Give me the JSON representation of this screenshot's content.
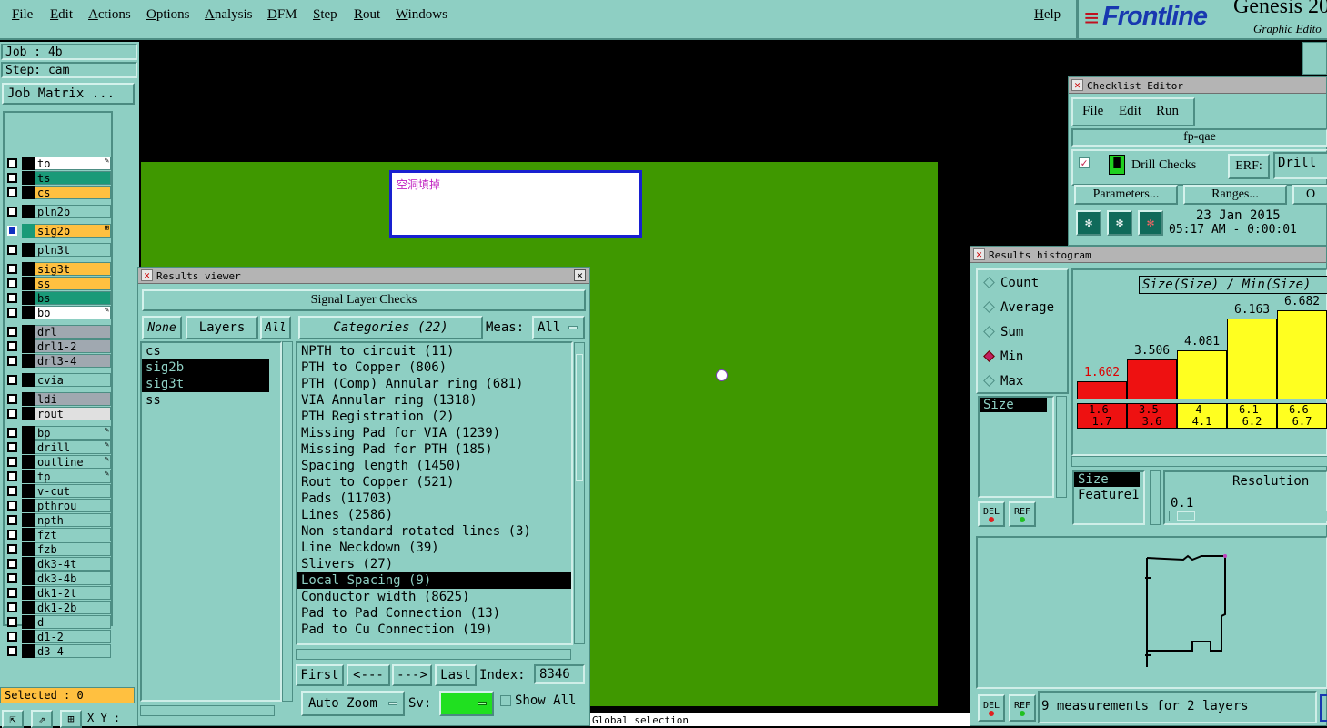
{
  "menu": {
    "items": [
      "File",
      "Edit",
      "Actions",
      "Options",
      "Analysis",
      "DFM",
      "Step",
      "Rout",
      "Windows"
    ],
    "help": "Help"
  },
  "logo": {
    "brand": "Frontline",
    "product": "Genesis 20",
    "subtitle": "Graphic Edito"
  },
  "job": {
    "job": "Job : 4b",
    "step": "Step: cam",
    "matrix_button": "Job Matrix ..."
  },
  "layers": [
    {
      "name": "to",
      "color": "#ffffff",
      "mark": "✎"
    },
    {
      "name": "ts",
      "color": "#1a9a78",
      "mark": ""
    },
    {
      "name": "cs",
      "color": "#ffc040",
      "mark": ""
    },
    {
      "name": "pln2b",
      "color": "#8ecfc3",
      "mark": ""
    },
    {
      "name": "sig2b",
      "color": "#ffc040",
      "mark": "⊞",
      "active": true
    },
    {
      "name": "pln3t",
      "color": "#8ecfc3",
      "mark": ""
    },
    {
      "name": "sig3t",
      "color": "#ffc040",
      "mark": ""
    },
    {
      "name": "ss",
      "color": "#ffc040",
      "mark": ""
    },
    {
      "name": "bs",
      "color": "#1a9a78",
      "mark": ""
    },
    {
      "name": "bo",
      "color": "#ffffff",
      "mark": "✎"
    },
    {
      "name": "drl",
      "color": "#a0a8b0",
      "mark": ""
    },
    {
      "name": "drl1-2",
      "color": "#a0a8b0",
      "mark": ""
    },
    {
      "name": "drl3-4",
      "color": "#a0a8b0",
      "mark": ""
    },
    {
      "name": "cvia",
      "color": "#8ecfc3",
      "mark": ""
    },
    {
      "name": "ldi",
      "color": "#a0a8b0",
      "mark": ""
    },
    {
      "name": "rout",
      "color": "#e0e0e0",
      "mark": ""
    },
    {
      "name": "bp",
      "color": "#8ecfc3",
      "mark": "✎"
    },
    {
      "name": "drill",
      "color": "#8ecfc3",
      "mark": "✎"
    },
    {
      "name": "outline",
      "color": "#8ecfc3",
      "mark": "✎"
    },
    {
      "name": "tp",
      "color": "#8ecfc3",
      "mark": "✎"
    },
    {
      "name": "v-cut",
      "color": "#8ecfc3",
      "mark": ""
    },
    {
      "name": "pthrou",
      "color": "#8ecfc3",
      "mark": ""
    },
    {
      "name": "npth",
      "color": "#8ecfc3",
      "mark": ""
    },
    {
      "name": "fzt",
      "color": "#8ecfc3",
      "mark": ""
    },
    {
      "name": "fzb",
      "color": "#8ecfc3",
      "mark": ""
    },
    {
      "name": "dk3-4t",
      "color": "#8ecfc3",
      "mark": ""
    },
    {
      "name": "dk3-4b",
      "color": "#8ecfc3",
      "mark": ""
    },
    {
      "name": "dk1-2t",
      "color": "#8ecfc3",
      "mark": ""
    },
    {
      "name": "dk1-2b",
      "color": "#8ecfc3",
      "mark": ""
    },
    {
      "name": "d",
      "color": "#8ecfc3",
      "mark": ""
    },
    {
      "name": "d1-2",
      "color": "#8ecfc3",
      "mark": ""
    },
    {
      "name": "d3-4",
      "color": "#8ecfc3",
      "mark": ""
    }
  ],
  "selected": "Selected : 0",
  "xy": "X Y :",
  "canvas": {
    "note": "空洞填掉",
    "status": "Global selection"
  },
  "results_viewer": {
    "title": "Results viewer",
    "header": "Signal Layer Checks",
    "none": "None",
    "layers": "Layers",
    "all": "All",
    "categories_btn": "Categories (22)",
    "meas_label": "Meas:",
    "meas_value": "All",
    "layer_list": [
      {
        "t": "cs",
        "sel": false
      },
      {
        "t": "sig2b",
        "sel": true
      },
      {
        "t": "sig3t",
        "sel": true
      },
      {
        "t": "ss",
        "sel": false
      }
    ],
    "category_list": [
      {
        "t": "NPTH to circuit (11)",
        "sel": false
      },
      {
        "t": "PTH to Copper (806)",
        "sel": false
      },
      {
        "t": "PTH (Comp) Annular ring (681)",
        "sel": false
      },
      {
        "t": "VIA Annular ring (1318)",
        "sel": false
      },
      {
        "t": "PTH Registration (2)",
        "sel": false
      },
      {
        "t": "Missing Pad for VIA (1239)",
        "sel": false
      },
      {
        "t": "Missing Pad for PTH (185)",
        "sel": false
      },
      {
        "t": "Spacing length (1450)",
        "sel": false
      },
      {
        "t": "Rout to Copper (521)",
        "sel": false
      },
      {
        "t": "Pads (11703)",
        "sel": false
      },
      {
        "t": "Lines (2586)",
        "sel": false
      },
      {
        "t": "Non standard rotated lines (3)",
        "sel": false
      },
      {
        "t": "Line Neckdown (39)",
        "sel": false
      },
      {
        "t": "Slivers (27)",
        "sel": false
      },
      {
        "t": "Local Spacing (9)",
        "sel": true
      },
      {
        "t": "Conductor width (8625)",
        "sel": false
      },
      {
        "t": "Pad to Pad Connection (13)",
        "sel": false
      },
      {
        "t": "Pad to Cu Connection (19)",
        "sel": false
      }
    ],
    "first": "First",
    "prev": "<---",
    "next": "--->",
    "last": "Last",
    "index_label": "Index:",
    "index_value": "8346",
    "zoom": "Auto Zoom",
    "sv": "Sv:",
    "show_all": "Show All"
  },
  "checklist": {
    "title": "Checklist Editor",
    "menu": [
      "File",
      "Edit",
      "Run"
    ],
    "name": "fp-qae",
    "check": "Drill Checks",
    "erf": "ERF:",
    "erf_value": "Drill",
    "params": "Parameters...",
    "ranges": "Ranges...",
    "o": "O",
    "date": "23 Jan 2015",
    "time": "05:17 AM - 0:00:01"
  },
  "histogram": {
    "title": "Results histogram",
    "modes": [
      {
        "t": "Count",
        "on": false
      },
      {
        "t": "Average",
        "on": false
      },
      {
        "t": "Sum",
        "on": false
      },
      {
        "t": "Min",
        "on": true
      },
      {
        "t": "Max",
        "on": false
      }
    ],
    "chart_title": "Size(Size) / Min(Size)",
    "left_list": "Size",
    "bars": [
      {
        "value": "1.602",
        "range": "1.6-\n1.7",
        "color": "#ee1111",
        "label_color": "#dd0000"
      },
      {
        "value": "3.506",
        "range": "3.5-\n3.6",
        "color": "#ee1111",
        "label_color": "#000"
      },
      {
        "value": "4.081",
        "range": "4-\n4.1",
        "color": "#ffff20",
        "label_color": "#000"
      },
      {
        "value": "6.163",
        "range": "6.1-\n6.2",
        "color": "#ffff20",
        "label_color": "#000"
      },
      {
        "value": "6.682",
        "range": "6.6-\n6.7",
        "color": "#ffff20",
        "label_color": "#000"
      }
    ],
    "list2": [
      "Size",
      "Feature1"
    ],
    "resolution_label": "Resolution",
    "resolution": "0.1",
    "del": "DEL",
    "ref": "REF",
    "status": "9 measurements for 2 layers"
  }
}
